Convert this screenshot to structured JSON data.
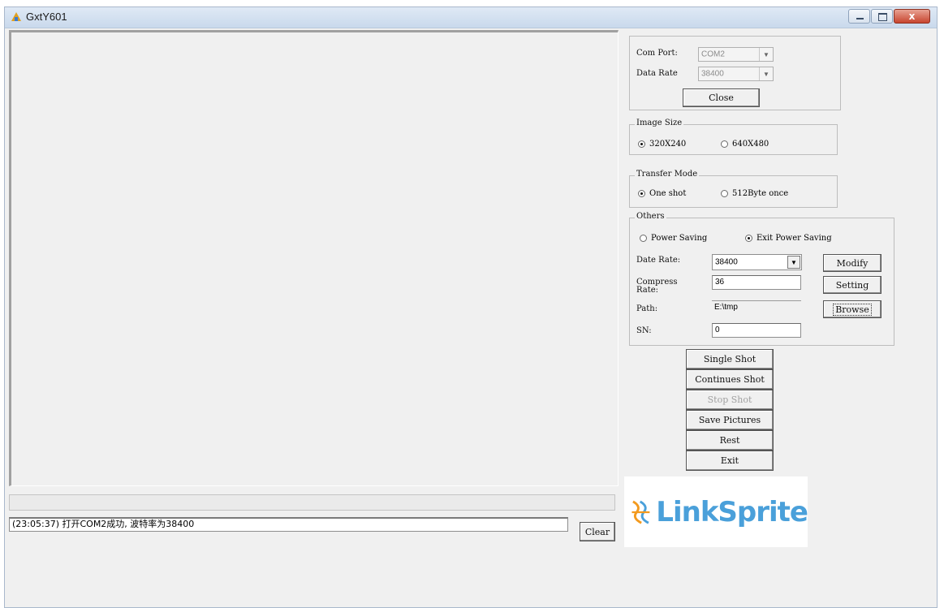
{
  "window": {
    "title": "GxtY601",
    "close_symbol": "x"
  },
  "log": {
    "text": "(23:05:37) 打开COM2成功, 波特率为38400",
    "clear_label": "Clear"
  },
  "com": {
    "port_label": "Com Port:",
    "port_value": "COM2",
    "rate_label": "Data Rate",
    "rate_value": "38400",
    "close_label": "Close"
  },
  "image_size": {
    "title": "Image Size",
    "options": [
      "320X240",
      "640X480"
    ],
    "selected": "320X240"
  },
  "transfer_mode": {
    "title": "Transfer Mode",
    "options": [
      "One shot",
      "512Byte once"
    ],
    "selected": "One shot"
  },
  "others": {
    "title": "Others",
    "power_options": [
      "Power Saving",
      "Exit Power Saving"
    ],
    "power_selected": "Exit Power Saving",
    "date_rate_label": "Date Rate:",
    "date_rate_value": "38400",
    "modify_label": "Modify",
    "compress_label": "Compress Rate:",
    "compress_value": "36",
    "setting_label": "Setting",
    "path_label": "Path:",
    "path_value": "E:\\tmp",
    "browse_label": "Browse",
    "sn_label": "SN:",
    "sn_value": "0"
  },
  "actions": {
    "single_shot": "Single Shot",
    "continues_shot": "Continues Shot",
    "stop_shot": "Stop Shot",
    "save_pictures": "Save Pictures",
    "rest": "Rest",
    "exit": "Exit"
  },
  "logo": {
    "text": "LinkSprite",
    "color_blue": "#4aa0da",
    "color_orange": "#f39a1e"
  }
}
